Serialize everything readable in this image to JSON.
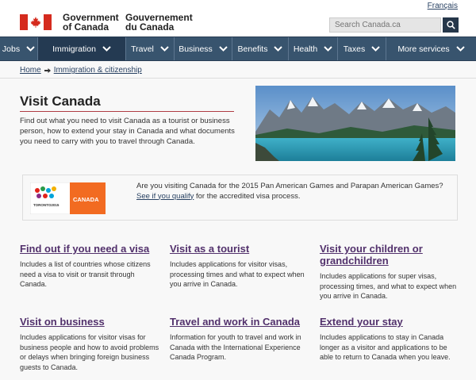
{
  "header": {
    "gov_en_line1": "Government",
    "gov_en_line2": "of Canada",
    "gov_fr_line1": "Gouvernement",
    "gov_fr_line2": "du Canada",
    "lang_toggle": "Français",
    "search_placeholder": "Search Canada.ca"
  },
  "nav": {
    "items": [
      {
        "label": "Jobs"
      },
      {
        "label": "Immigration"
      },
      {
        "label": "Travel"
      },
      {
        "label": "Business"
      },
      {
        "label": "Benefits"
      },
      {
        "label": "Health"
      },
      {
        "label": "Taxes"
      },
      {
        "label": "More services"
      }
    ],
    "active_index": 1
  },
  "breadcrumb": {
    "home": "Home",
    "current": "Immigration & citizenship"
  },
  "intro": {
    "title": "Visit Canada",
    "text": "Find out what you need to visit Canada as a tourist or business person, how to extend your stay in Canada and what documents you need to carry with you to travel through Canada."
  },
  "panam": {
    "text_before": "Are you visiting Canada for the 2015 Pan American Games and Parapan American Games?",
    "link_text": "See if you qualify",
    "text_after": "for the accredited visa process.",
    "logo_canada": "CANADA",
    "logo_toronto": "TORONTO2015"
  },
  "cards": [
    {
      "title": "Find out if you need a visa",
      "desc": "Includes a list of countries whose citizens need a visa to visit or transit through Canada."
    },
    {
      "title": "Visit as a tourist",
      "desc": "Includes applications for visitor visas, processing times and what to expect when you arrive in Canada."
    },
    {
      "title": "Visit your children or grandchildren",
      "desc": "Includes applications for super visas, processing times, and what to expect when you arrive in Canada."
    },
    {
      "title": "Visit on business",
      "desc": "Includes applications for visitor visas for business people and how to avoid problems or delays when bringing foreign business guests to Canada."
    },
    {
      "title": "Travel and work in Canada",
      "desc": "Information for youth to travel and work in Canada with the International Experience Canada Program."
    },
    {
      "title": "Extend your stay",
      "desc": "Includes applications to stay in Canada longer as a visitor and applications to be able to return to Canada when you leave."
    }
  ],
  "colors": {
    "nav_bg": "#38546e",
    "nav_active": "#243a52",
    "link_visited": "#52316c",
    "flag_red": "#d52b1e",
    "title_rule": "#af3c43"
  }
}
